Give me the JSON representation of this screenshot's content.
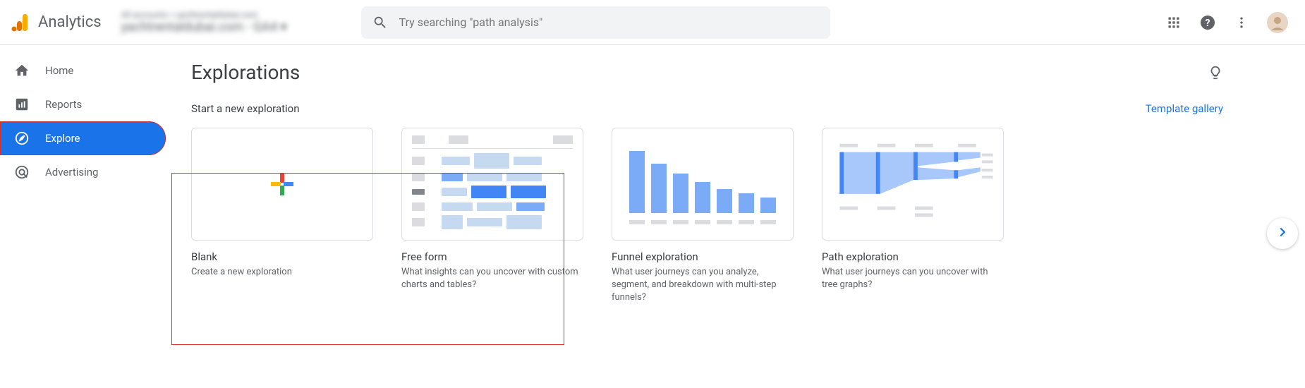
{
  "header": {
    "app_name": "Analytics",
    "account_top": "All accounts > yachtrentaldubai.com",
    "account_bottom": "yachtrentaldubai.com - GA4 ▾",
    "search_placeholder": "Try searching \"path analysis\""
  },
  "sidebar": {
    "items": [
      {
        "label": "Home",
        "icon": "home-icon"
      },
      {
        "label": "Reports",
        "icon": "reports-icon"
      },
      {
        "label": "Explore",
        "icon": "explore-icon"
      },
      {
        "label": "Advertising",
        "icon": "advertising-icon"
      }
    ]
  },
  "main": {
    "title": "Explorations",
    "subtitle": "Start a new exploration",
    "template_gallery": "Template gallery",
    "cards": [
      {
        "title": "Blank",
        "desc": "Create a new exploration"
      },
      {
        "title": "Free form",
        "desc": "What insights can you uncover with custom charts and tables?"
      },
      {
        "title": "Funnel exploration",
        "desc": "What user journeys can you analyze, segment, and breakdown with multi-step funnels?"
      },
      {
        "title": "Path exploration",
        "desc": "What user journeys can you uncover with tree graphs?"
      }
    ]
  }
}
